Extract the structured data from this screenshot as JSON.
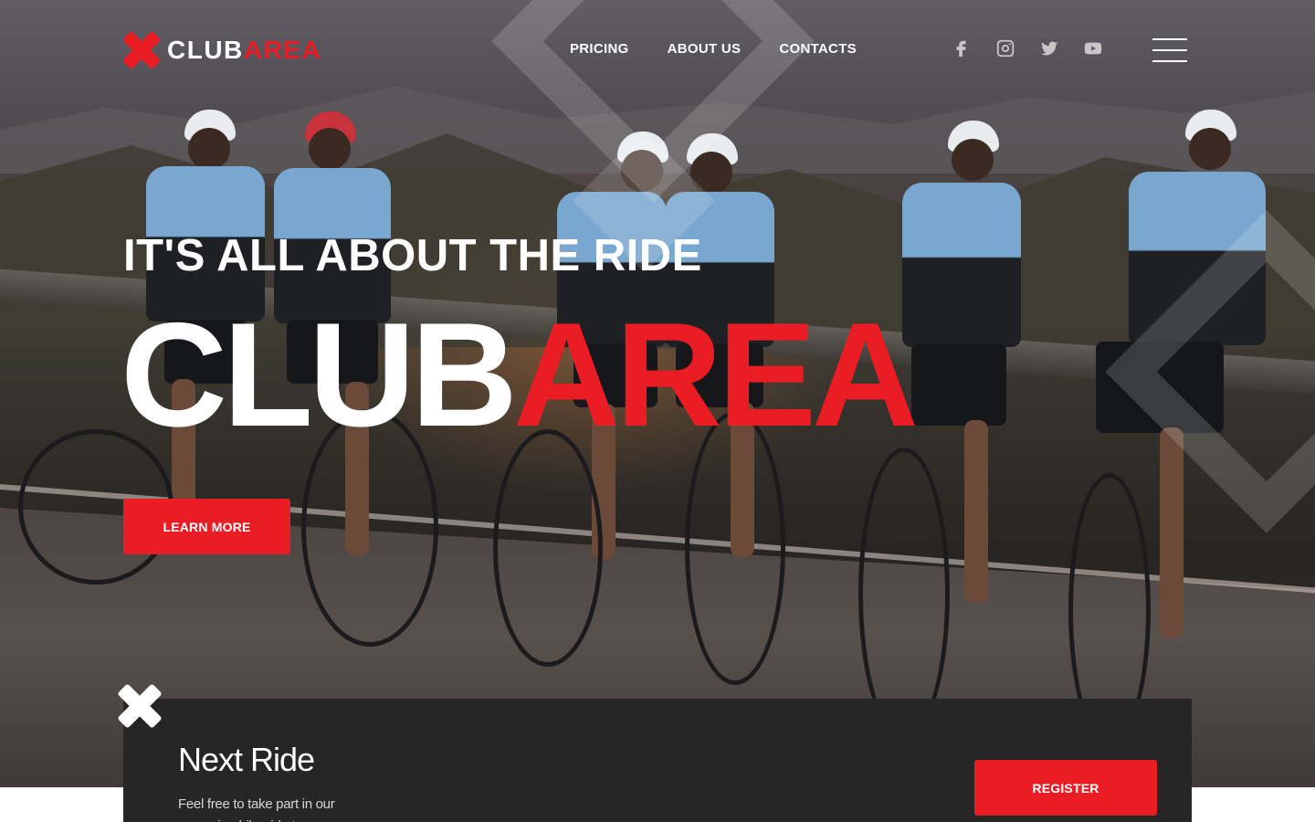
{
  "brand": {
    "name_white": "CLUB",
    "name_red": "AREA"
  },
  "nav": {
    "items": [
      "PRICING",
      "ABOUT US",
      "CONTACTS"
    ]
  },
  "social": [
    "facebook-icon",
    "instagram-icon",
    "twitter-icon",
    "youtube-icon"
  ],
  "hero": {
    "tagline": "IT'S ALL ABOUT THE RIDE",
    "title_white": "CLUB",
    "title_red": "AREA",
    "cta": "LEARN MORE"
  },
  "next_ride": {
    "title": "Next Ride",
    "description": "Feel free to take part in our upcoming bike ride to",
    "cta": "REGISTER"
  },
  "colors": {
    "accent": "#ea1d25",
    "card_bg": "#262626"
  }
}
